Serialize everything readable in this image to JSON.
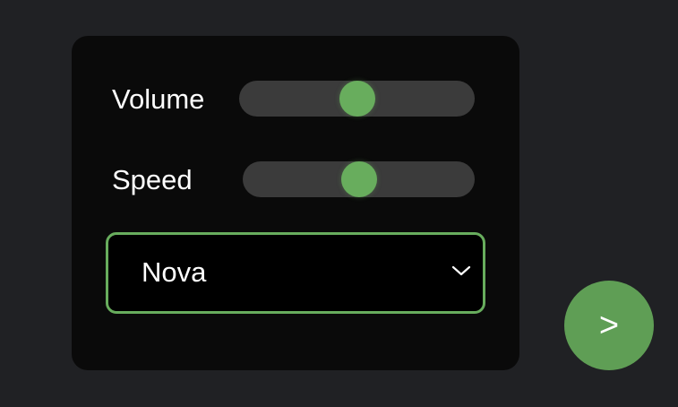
{
  "controls": {
    "volume": {
      "label": "Volume",
      "value_fraction": 0.5
    },
    "speed": {
      "label": "Speed",
      "value_fraction": 0.5
    },
    "voice_select": {
      "selected": "Nova",
      "icon": "chevron-down-icon"
    },
    "next_button": {
      "label": ">",
      "icon": "next-icon"
    }
  },
  "colors": {
    "background": "#202124",
    "panel": "#0a0a0a",
    "accent": "#68ad5d",
    "track": "#3b3b3b",
    "text": "#ffffff"
  }
}
